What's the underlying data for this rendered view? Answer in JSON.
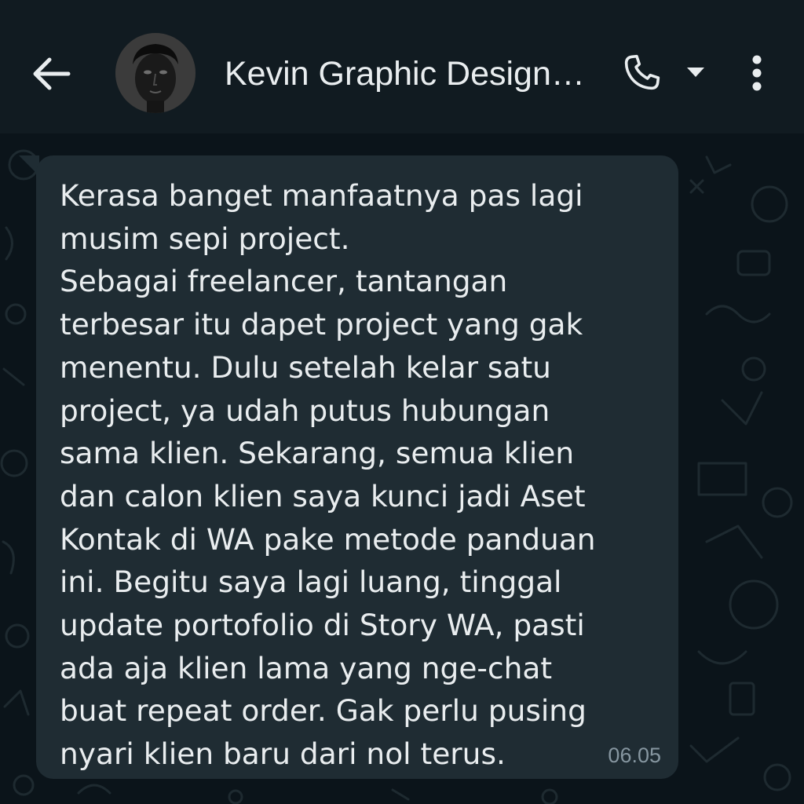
{
  "header": {
    "contact_name": "Kevin Graphic Design…",
    "icons": {
      "back": "arrow-back-icon",
      "call": "phone-icon",
      "dropdown": "caret-down-icon",
      "menu": "more-vertical-icon"
    }
  },
  "message": {
    "text": "Kerasa banget manfaatnya pas lagi\nmusim sepi project.\nSebagai freelancer, tantangan\nterbesar itu dapet project yang gak\nmenentu. Dulu setelah kelar satu\nproject, ya udah putus hubungan\nsama klien. Sekarang, semua klien\ndan calon klien saya kunci jadi Aset\nKontak di WA pake metode panduan\nini. Begitu saya lagi luang, tinggal\nupdate portofolio di Story WA, pasti\nada aja klien lama yang nge-chat\nbuat repeat order. Gak perlu pusing\nnyari klien baru dari nol terus.",
    "time": "06.05"
  },
  "colors": {
    "header_bg": "#111b21",
    "chat_bg": "#0b141a",
    "bubble_bg": "#1f2c33",
    "text": "#e9edef",
    "timestamp": "#8696a0"
  }
}
